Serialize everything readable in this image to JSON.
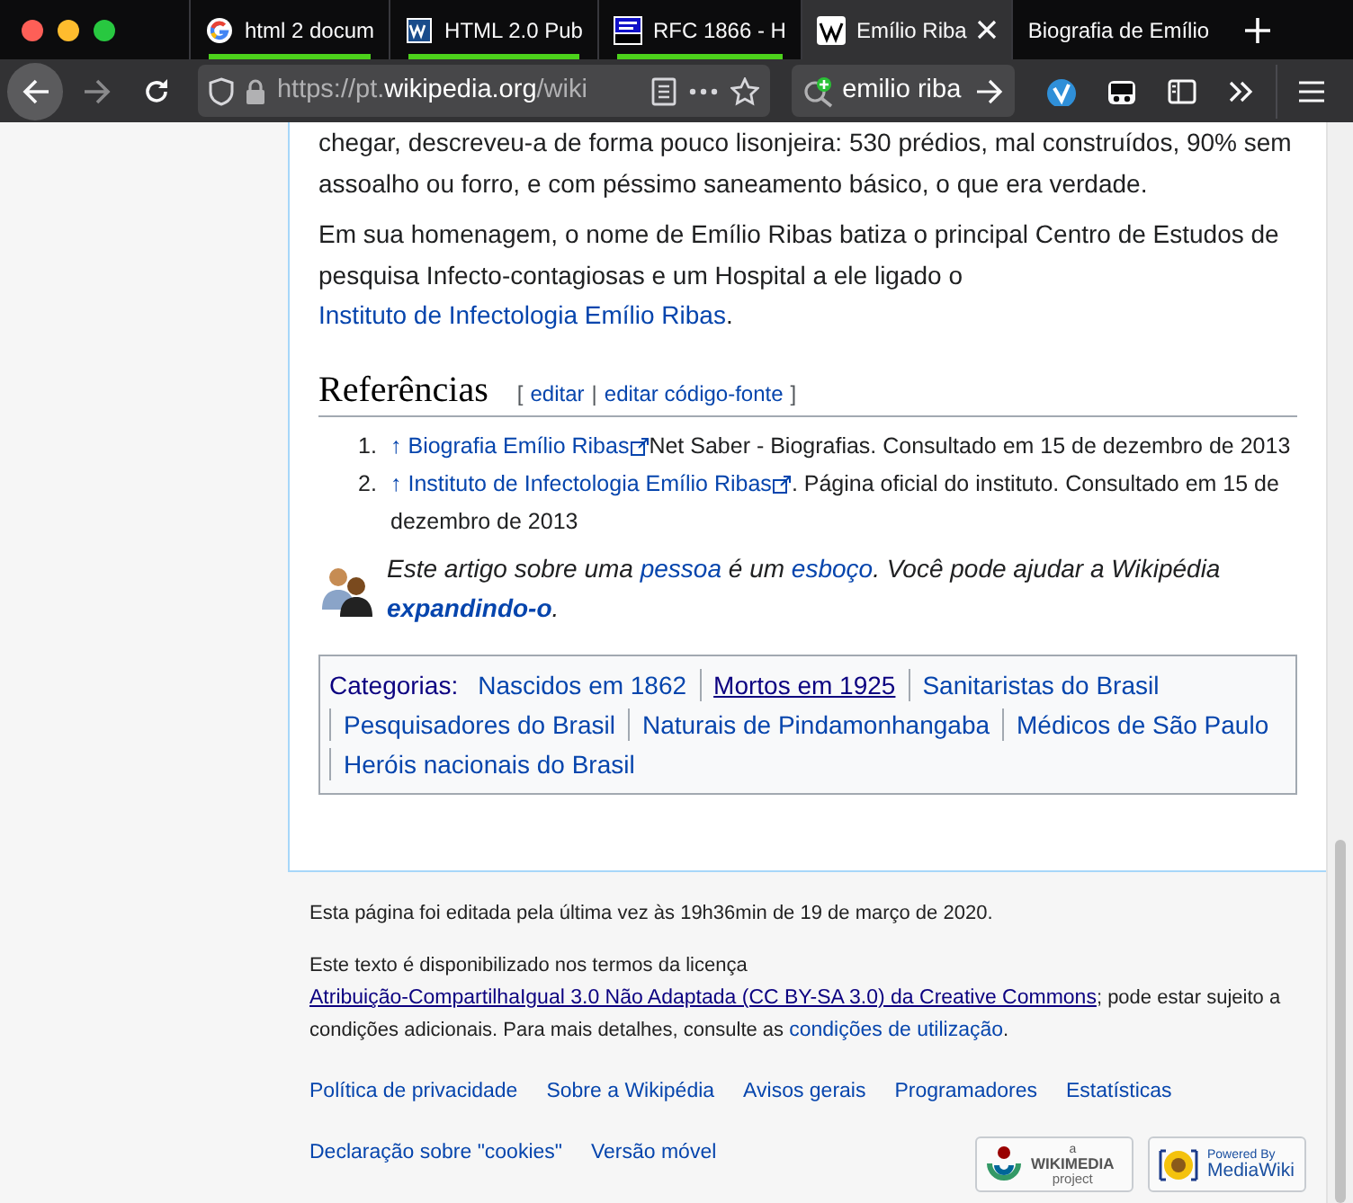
{
  "browser": {
    "tabs": [
      {
        "label": "html 2 docum",
        "kind": "google",
        "selected": false,
        "container_line": true
      },
      {
        "label": "HTML 2.0 Pub",
        "kind": "w3",
        "selected": false,
        "container_line": true
      },
      {
        "label": "RFC 1866 - H",
        "kind": "rfc",
        "selected": false,
        "container_line": true
      },
      {
        "label": "Emílio Riba",
        "kind": "wiki",
        "selected": true,
        "container_line": false
      },
      {
        "label": "Biografia de Emílio",
        "kind": "page",
        "selected": false,
        "container_line": false
      }
    ],
    "url": "https://pt.**wikipedia.org**/wiki",
    "search": {
      "value": "emilio riba"
    }
  },
  "article": {
    "paragraphs": [
      {
        "parts": [
          {
            "text": "chegar, descreveu-a de forma pouco lisonjeira: 530 prédios, mal construídos, 90% sem assoalho ou forro, e com péssimo saneamento básico, o que era verdade."
          }
        ]
      },
      {
        "parts": [
          {
            "text": "Em sua homenagem, o nome de Emílio Ribas batiza o principal Centro de Estudos de pesquisa Infecto-contagiosas e um Hospital a ele ligado o "
          },
          {
            "link": "Instituto de Infectologia Emílio Ribas"
          },
          {
            "text": "."
          }
        ]
      }
    ],
    "section": {
      "title": "Referências",
      "open": "[",
      "edit": "editar",
      "sep": "|",
      "edit_source": "editar código-fonte",
      "close": "]"
    },
    "references": [
      {
        "number": "1.",
        "back": "↑",
        "title": "Biografia Emílio Ribas",
        "rest": "Net Saber - Biografias. Consultado em 15 de dezembro de 2013"
      },
      {
        "number": "2.",
        "back": "↑",
        "title": "Instituto de Infectologia Emílio Ribas",
        "rest": ". Página oficial do instituto. Consultado em 15 de dezembro de 2013"
      }
    ],
    "stub": {
      "parts": [
        {
          "text": "Este artigo sobre uma "
        },
        {
          "link": "pessoa"
        },
        {
          "text": " é um "
        },
        {
          "link": "esboço"
        },
        {
          "text": ". Você pode ajudar a Wikipédia "
        },
        {
          "link": "expandindo-o",
          "bold": true
        },
        {
          "text": "."
        }
      ]
    },
    "categories": {
      "label": "Categorias:",
      "items": [
        {
          "name": "Nascidos em 1862",
          "visited": false
        },
        {
          "name": "Mortos em 1925",
          "visited": true
        },
        {
          "name": "Sanitaristas do Brasil",
          "visited": false
        },
        {
          "name": "Pesquisadores do Brasil",
          "visited": false
        },
        {
          "name": "Naturais de Pindamonhangaba",
          "visited": false
        },
        {
          "name": "Médicos de São Paulo",
          "visited": false
        },
        {
          "name": "Heróis nacionais do Brasil",
          "visited": false
        }
      ]
    }
  },
  "footer": {
    "last_edit": "Esta página foi editada pela última vez às 19h36min de 19 de março de 2020.",
    "license": {
      "parts": [
        {
          "text": "Este texto é disponibilizado nos termos da licença "
        },
        {
          "link": "Atribuição-CompartilhaIgual 3.0 Não Adaptada (CC BY-SA 3.0) da Creative Commons",
          "visited": true
        },
        {
          "text": "; pode estar sujeito a condições adicionais. Para mais detalhes, consulte as "
        },
        {
          "link": "condições de utilização"
        },
        {
          "text": "."
        }
      ]
    },
    "links": [
      "Política de privacidade",
      "Sobre a Wikipédia",
      "Avisos gerais",
      "Programadores",
      "Estatísticas"
    ],
    "links_2": [
      "Declaração sobre \"cookies\"",
      "Versão móvel"
    ],
    "badges": [
      {
        "kind": "wikimedia",
        "small": "a",
        "big": "WIKIMEDIA",
        "sub": "project"
      },
      {
        "kind": "mediawiki",
        "small": "Powered By",
        "big": "MediaWiki"
      }
    ]
  }
}
